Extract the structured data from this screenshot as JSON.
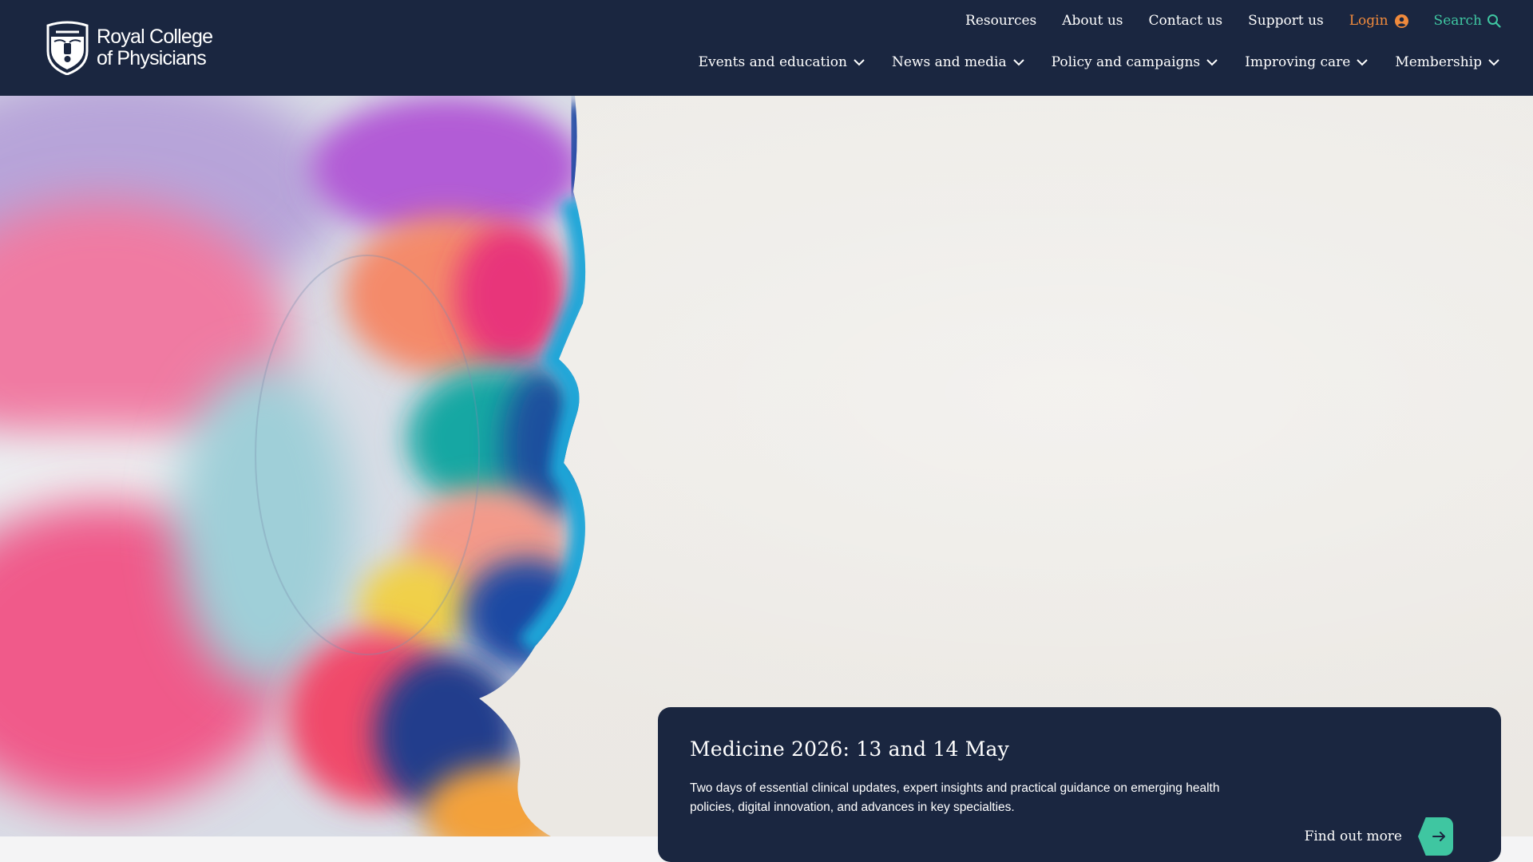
{
  "brand": {
    "logo_line1": "Royal College",
    "logo_line2": "of Physicians"
  },
  "utility_nav": {
    "resources": "Resources",
    "about": "About us",
    "contact": "Contact us",
    "support": "Support us",
    "login": "Login",
    "search": "Search"
  },
  "main_nav": [
    {
      "label": "Events and education",
      "icon": "chevron-down-icon"
    },
    {
      "label": "News and media",
      "icon": "chevron-down-icon"
    },
    {
      "label": "Policy and campaigns",
      "icon": "chevron-down-icon"
    },
    {
      "label": "Improving care",
      "icon": "chevron-down-icon"
    },
    {
      "label": "Membership",
      "icon": "chevron-down-icon"
    }
  ],
  "promo": {
    "title": "Medicine 2026: 13 and 14 May",
    "description": "Two days of essential clinical updates, expert insights and practical guidance on emerging health policies, digital innovation, and advances in key specialties.",
    "cta": "Find out more"
  },
  "colors": {
    "header_bg": "#1a2640",
    "login": "#f08a3c",
    "search": "#3fc6a1",
    "cta_accent": "#3fc6a1"
  }
}
